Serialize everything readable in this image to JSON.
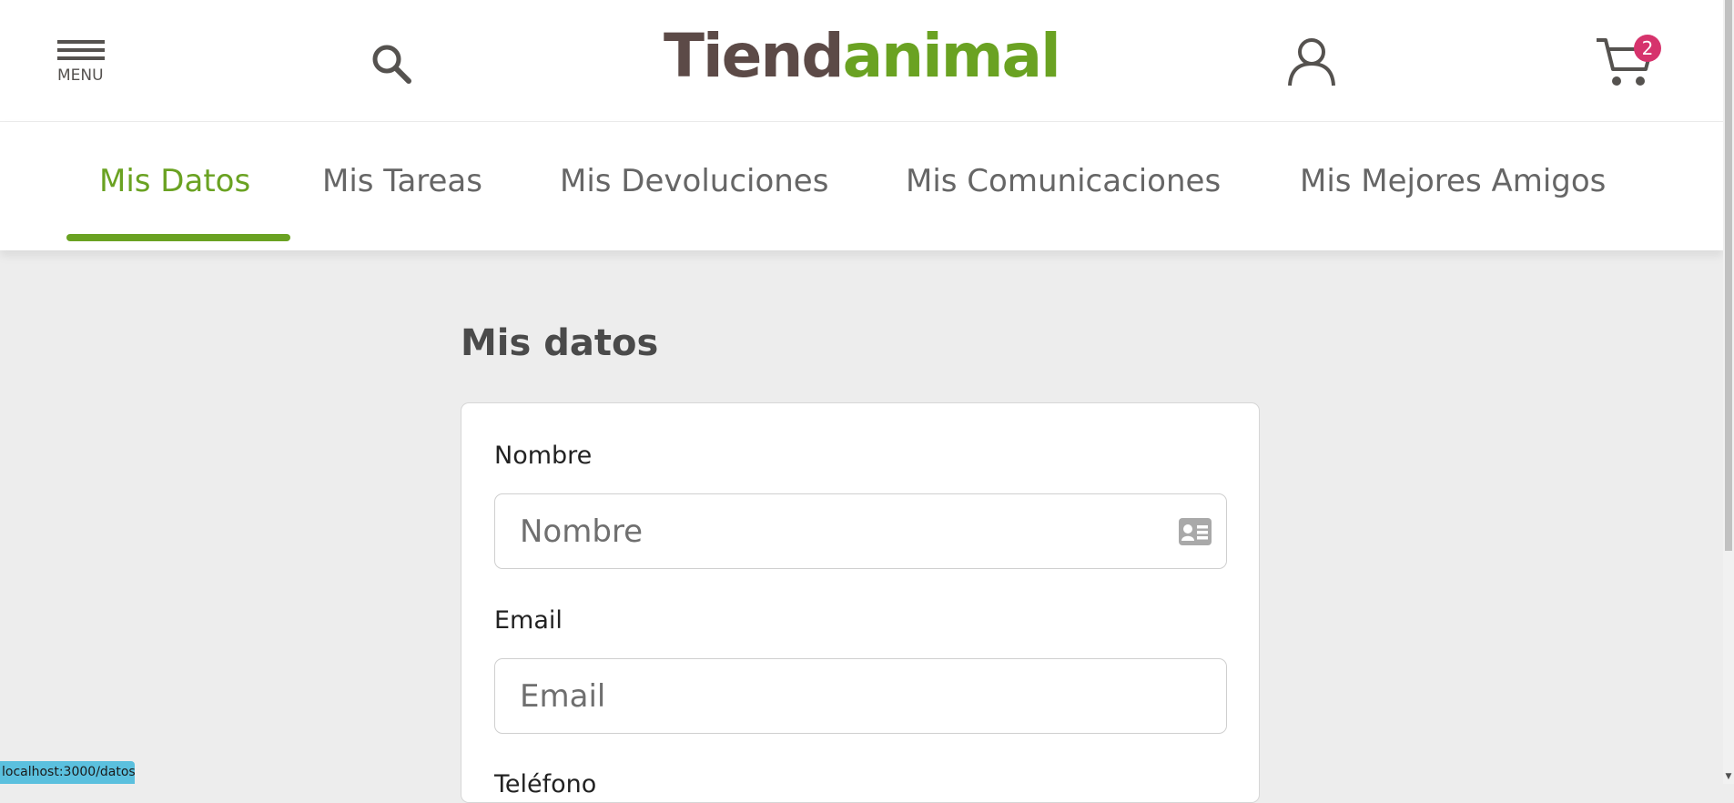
{
  "header": {
    "menu_label": "MENU",
    "logo_part1": "Tiend",
    "logo_part2": "animal",
    "cart_count": "2"
  },
  "nav": {
    "tabs": [
      {
        "label": "Mis Datos",
        "active": true
      },
      {
        "label": "Mis Tareas",
        "active": false
      },
      {
        "label": "Mis Devoluciones",
        "active": false
      },
      {
        "label": "Mis Comunicaciones",
        "active": false
      },
      {
        "label": "Mis Mejores Amigos",
        "active": false
      }
    ]
  },
  "main": {
    "title": "Mis datos",
    "form": {
      "fields": [
        {
          "label": "Nombre",
          "placeholder": "Nombre",
          "value": "",
          "icon": "id-card-icon"
        },
        {
          "label": "Email",
          "placeholder": "Email",
          "value": ""
        },
        {
          "label": "Teléfono"
        }
      ]
    }
  },
  "status_bar": {
    "url": "localhost:3000/datos"
  },
  "colors": {
    "brand_green": "#6aa222",
    "brand_brown": "#5c4a47",
    "badge": "#d6336c",
    "text_gray": "#666666",
    "page_background": "#ededed",
    "status_bar": "#5bc0de"
  }
}
